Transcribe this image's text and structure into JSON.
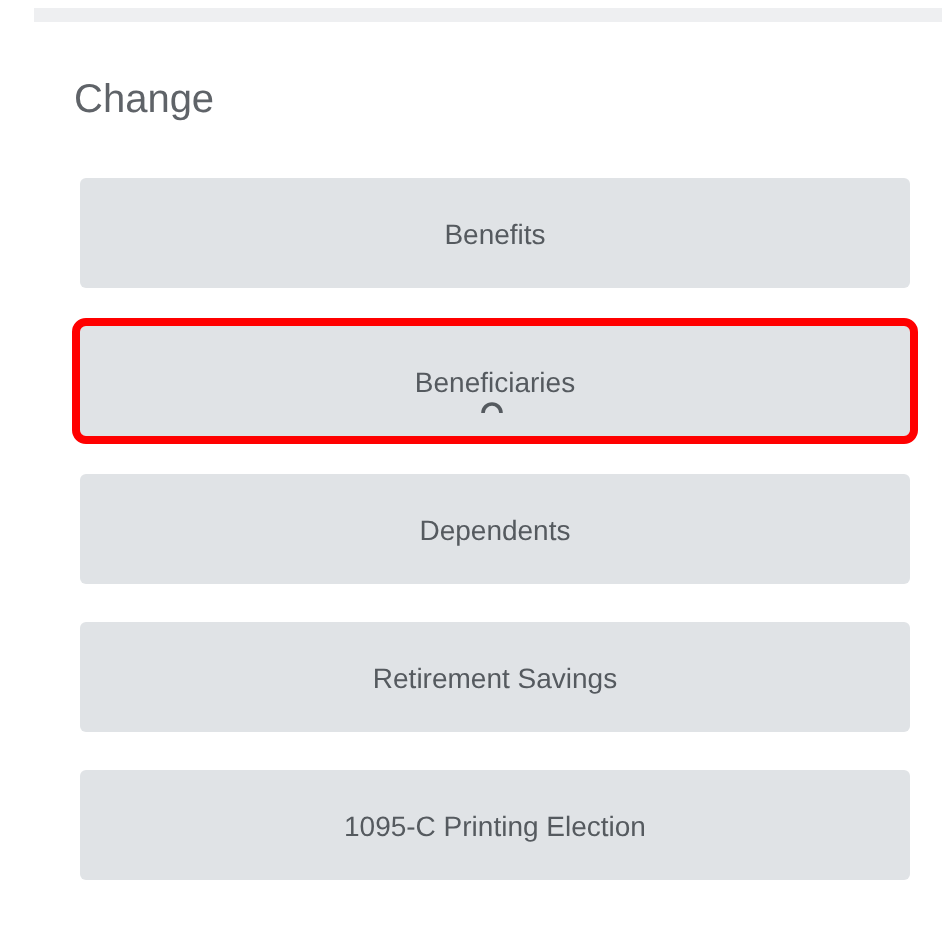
{
  "heading": "Change",
  "buttons": [
    {
      "label": "Benefits",
      "highlighted": false
    },
    {
      "label": "Beneficiaries",
      "highlighted": true
    },
    {
      "label": "Dependents",
      "highlighted": false
    },
    {
      "label": "Retirement Savings",
      "highlighted": false
    },
    {
      "label": "1095-C Printing Election",
      "highlighted": false
    }
  ]
}
